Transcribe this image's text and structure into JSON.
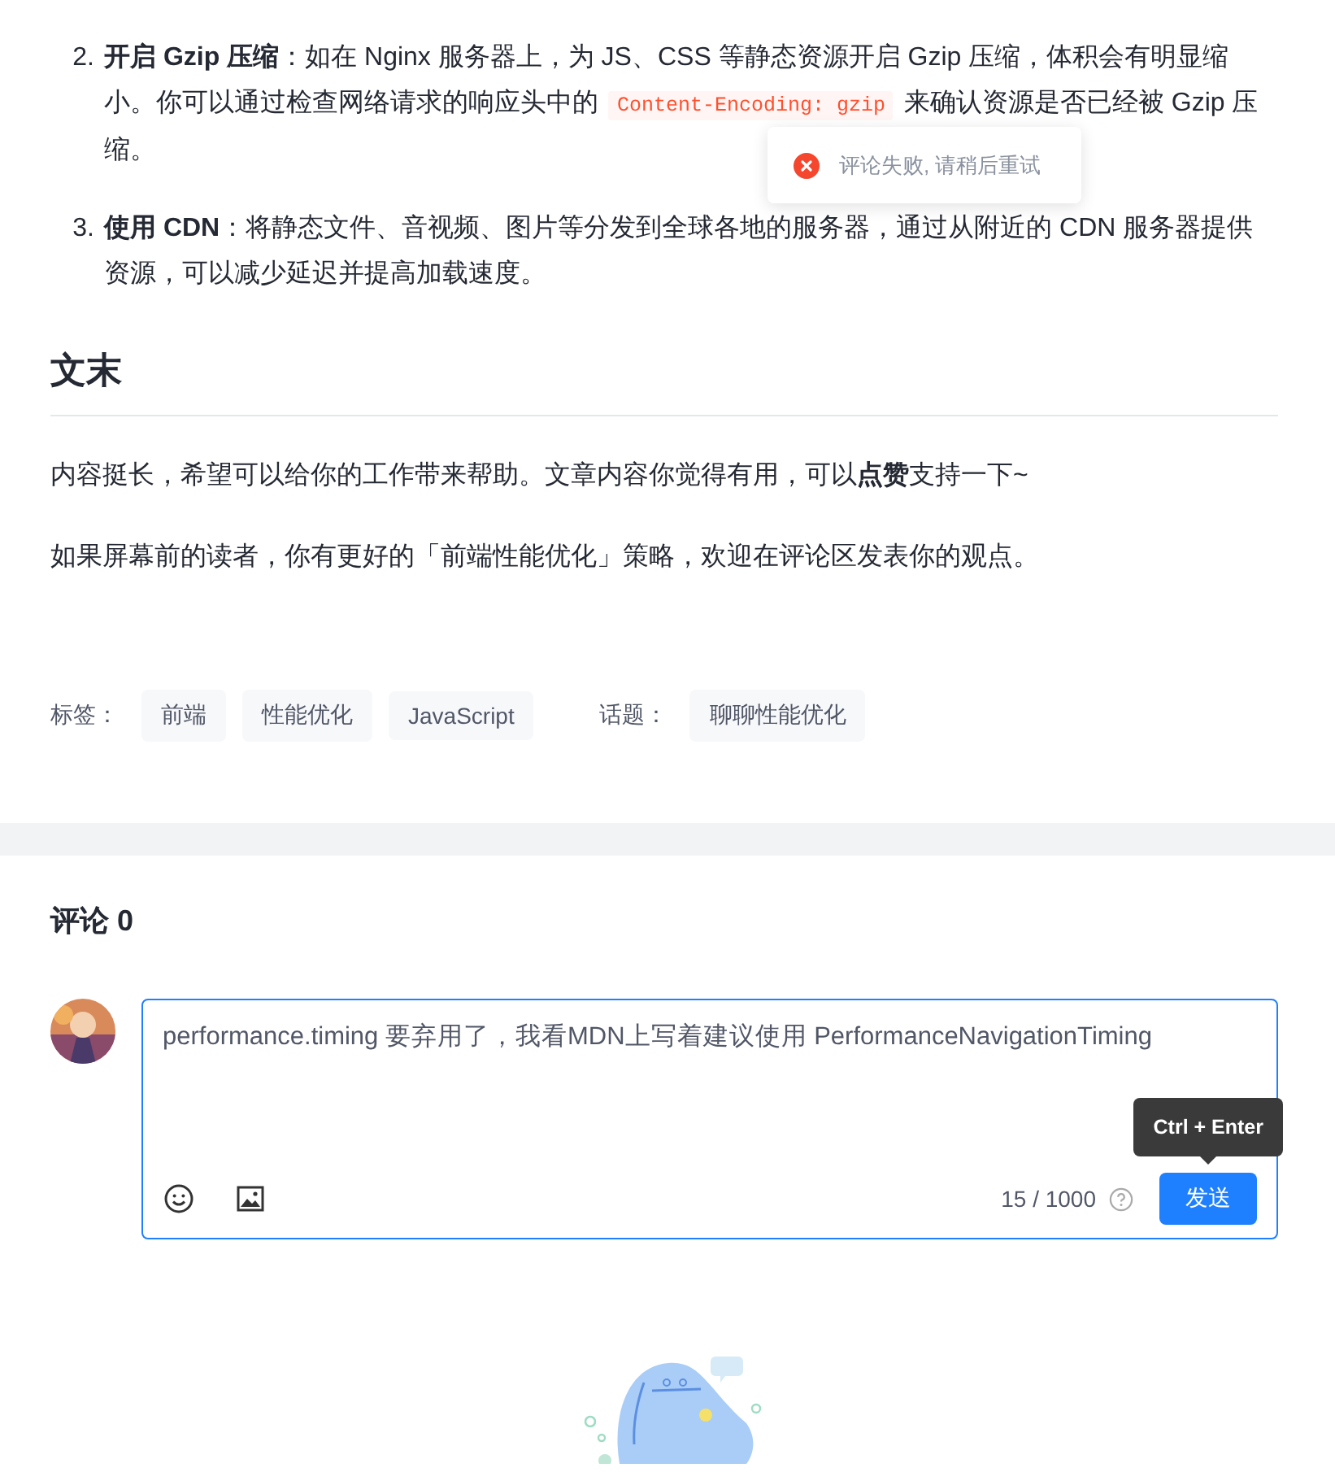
{
  "article": {
    "list": [
      {
        "number": "2.",
        "title": "开启 Gzip 压缩",
        "text": "：如在 Nginx 服务器上，为 JS、CSS 等静态资源开启 Gzip 压缩，体积会有明显缩小。你可以通过检查网络请求的响应头中的 ",
        "code": "Content-Encoding: gzip",
        "text_after": " 来确认资源是否已经被 Gzip 压缩。"
      },
      {
        "number": "3.",
        "title": "使用 CDN",
        "text": "：将静态文件、音视频、图片等分发到全球各地的服务器，通过从附近的 CDN 服务器提供资源，可以减少延迟并提高加载速度。"
      }
    ],
    "heading": "文末",
    "paragraphs": [
      "内容挺长，希望可以给你的工作带来帮助。文章内容你觉得有用，可以**点赞**支持一下~",
      "如果屏幕前的读者，你有更好的「前端性能优化」策略，欢迎在评论区发表你的观点。"
    ],
    "tags_label": "标签：",
    "tags": [
      "前端",
      "性能优化",
      "JavaScript"
    ],
    "topic_label": "话题：",
    "topics": [
      "聊聊性能优化"
    ]
  },
  "toast": {
    "kind": "error",
    "message": "评论失败, 请稍后重试"
  },
  "comments": {
    "title": "评论 0",
    "input": {
      "value": "performance.timing 要弃用了，我看MDN上写着建议使用 PerformanceNavigationTiming"
    },
    "counter": "15 / 1000",
    "tooltip": "Ctrl + Enter",
    "send": "发送"
  }
}
